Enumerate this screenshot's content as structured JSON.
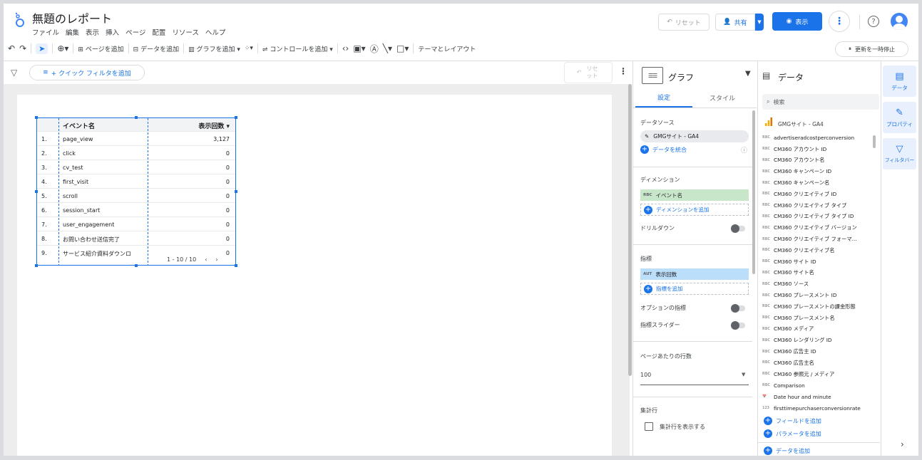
{
  "header": {
    "title": "無題のレポート",
    "menu": [
      "ファイル",
      "編集",
      "表示",
      "挿入",
      "ページ",
      "配置",
      "リソース",
      "ヘルプ"
    ],
    "reset_label": "リセット",
    "share_label": "共有",
    "view_label": "表示"
  },
  "toolbar": {
    "add_page": "ページを追加",
    "add_data": "データを追加",
    "add_chart": "グラフを追加",
    "add_control": "コントロールを追加",
    "theme_layout": "テーマとレイアウト",
    "pause_update": "更新を一時停止"
  },
  "filterbar": {
    "quick_filter": "+ クイック フィルタを追加",
    "reset": "リセ ット"
  },
  "table": {
    "col_dimension": "イベント名",
    "col_metric": "表示回数 ▾",
    "rows": [
      {
        "n": "1.",
        "event": "page_view",
        "value": "3,127"
      },
      {
        "n": "2.",
        "event": "click",
        "value": "0"
      },
      {
        "n": "3.",
        "event": "cv_test",
        "value": "0"
      },
      {
        "n": "4.",
        "event": "first_visit",
        "value": "0"
      },
      {
        "n": "5.",
        "event": "scroll",
        "value": "0"
      },
      {
        "n": "6.",
        "event": "session_start",
        "value": "0"
      },
      {
        "n": "7.",
        "event": "user_engagement",
        "value": "0"
      },
      {
        "n": "8.",
        "event": "お問い合わせ送信完了",
        "value": "0"
      },
      {
        "n": "9.",
        "event": "サービス紹介資料ダウンロ",
        "value": "0"
      }
    ],
    "pager": "1 - 10 / 10"
  },
  "props": {
    "title": "グラフ",
    "tab_setup": "設定",
    "tab_style": "スタイル",
    "datasource_label": "データソース",
    "datasource_name": "GMGサイト - GA4",
    "blend_label": "データを統合",
    "dimension_label": "ディメンション",
    "dimension_tag": "RBC",
    "dimension_chip": "イベント名",
    "dimension_add": "ディメンションを追加",
    "drilldown_label": "ドリルダウン",
    "metric_label": "指標",
    "metric_tag": "AUT",
    "metric_chip": "表示回数",
    "metric_add": "指標を追加",
    "optional_metric": "オプションの指標",
    "metric_slider": "指標スライダー",
    "rows_per_page_label": "ページあたりの行数",
    "rows_per_page_value": "100",
    "total_label": "集計行",
    "total_checkbox": "集計行を表示する"
  },
  "data_panel": {
    "title": "データ",
    "search_placeholder": "検索",
    "source": "GMGサイト - GA4",
    "fields": [
      {
        "tag": "RBC",
        "name": "advertiseradcostperconversion"
      },
      {
        "tag": "RBC",
        "name": "CM360 アカウント ID"
      },
      {
        "tag": "RBC",
        "name": "CM360 アカウント名"
      },
      {
        "tag": "RBC",
        "name": "CM360 キャンペーン ID"
      },
      {
        "tag": "RBC",
        "name": "CM360 キャンペーン名"
      },
      {
        "tag": "RBC",
        "name": "CM360 クリエイティブ ID"
      },
      {
        "tag": "RBC",
        "name": "CM360 クリエイティブ タイプ"
      },
      {
        "tag": "RBC",
        "name": "CM360 クリエイティブ タイプ ID"
      },
      {
        "tag": "RBC",
        "name": "CM360 クリエイティブ バージョン"
      },
      {
        "tag": "RBC",
        "name": "CM360 クリエイティブ フォーマ..."
      },
      {
        "tag": "RBC",
        "name": "CM360 クリエイティブ名"
      },
      {
        "tag": "RBC",
        "name": "CM360 サイト ID"
      },
      {
        "tag": "RBC",
        "name": "CM360 サイト名"
      },
      {
        "tag": "RBC",
        "name": "CM360 ソース"
      },
      {
        "tag": "RBC",
        "name": "CM360 プレースメント ID"
      },
      {
        "tag": "RBC",
        "name": "CM360 プレースメントの課金形態"
      },
      {
        "tag": "RBC",
        "name": "CM360 プレースメント名"
      },
      {
        "tag": "RBC",
        "name": "CM360 メディア"
      },
      {
        "tag": "RBC",
        "name": "CM360 レンダリング ID"
      },
      {
        "tag": "RBC",
        "name": "CM360 広告主 ID"
      },
      {
        "tag": "RBC",
        "name": "CM360 広告主名"
      },
      {
        "tag": "RBC",
        "name": "CM360 参照元 / メディア"
      },
      {
        "tag": "RBC",
        "name": "Comparison"
      },
      {
        "tag": "📅",
        "name": "Date hour and minute"
      },
      {
        "tag": "123",
        "name": "firsttimepurchaserconversionrate"
      }
    ],
    "add_field": "フィールドを追加",
    "add_parameter": "パラメータを追加",
    "add_data": "データを追加"
  },
  "rail": {
    "data": "データ",
    "properties": "プロパティ",
    "filter": "フィルタバー"
  },
  "colors": {
    "accent": "#1a73e8",
    "dimension": "#c8e6c9",
    "metric": "#bbdefb"
  }
}
